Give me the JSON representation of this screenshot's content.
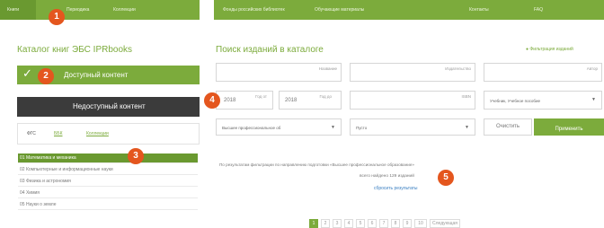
{
  "topnav": {
    "left_tabs": [
      "Книги",
      "Периодика",
      "Коллекции"
    ],
    "right_tabs": [
      "Фонды российских библиотек",
      "Обучающие материалы",
      "",
      "Контакты",
      "FAQ"
    ]
  },
  "sidebar": {
    "title": "Каталог книг ЭБС IPRbooks",
    "available_button": "Доступный контент",
    "unavailable_button": "Недоступный контент",
    "tabs": [
      "ФГС",
      "ББК",
      "Коллекции"
    ],
    "items": [
      "01 Математика и механика",
      "02 Компьютерные и информационные науки",
      "03 Физика и астрономия",
      "04 Химия",
      "05 Науки о земле"
    ]
  },
  "main": {
    "title": "Поиск изданий в каталоге",
    "filter_link": "Фильтрация изданий",
    "fields": {
      "title_placeholder": "Название",
      "publisher_placeholder": "Издательство",
      "author_placeholder": "Автор",
      "year_from": "2018",
      "year_from_label": "Год от",
      "year_to": "2018",
      "year_to_label": "Год до",
      "isbn_placeholder": "ISBN",
      "type_select": "Учебник, Учебное пособие",
      "level_select": "Высшее профессиональное об",
      "other_select": "Пусто"
    },
    "clear_button": "Очистить",
    "apply_button": "Применить",
    "result_text": "По результатам фильтрации по направлению подготовки «Высшее профессиональное образование»",
    "found_text": "всего найдено 129 изданий",
    "reset_link": "сбросить результаты",
    "pagination": [
      "1",
      "2",
      "3",
      "4",
      "5",
      "6",
      "7",
      "8",
      "9",
      "10",
      "Следующая"
    ]
  },
  "badges": [
    "1",
    "2",
    "3",
    "4",
    "5"
  ],
  "colors": {
    "accent": "#7cab3c",
    "badge": "#e4561e",
    "dark": "#3b3b3b"
  }
}
